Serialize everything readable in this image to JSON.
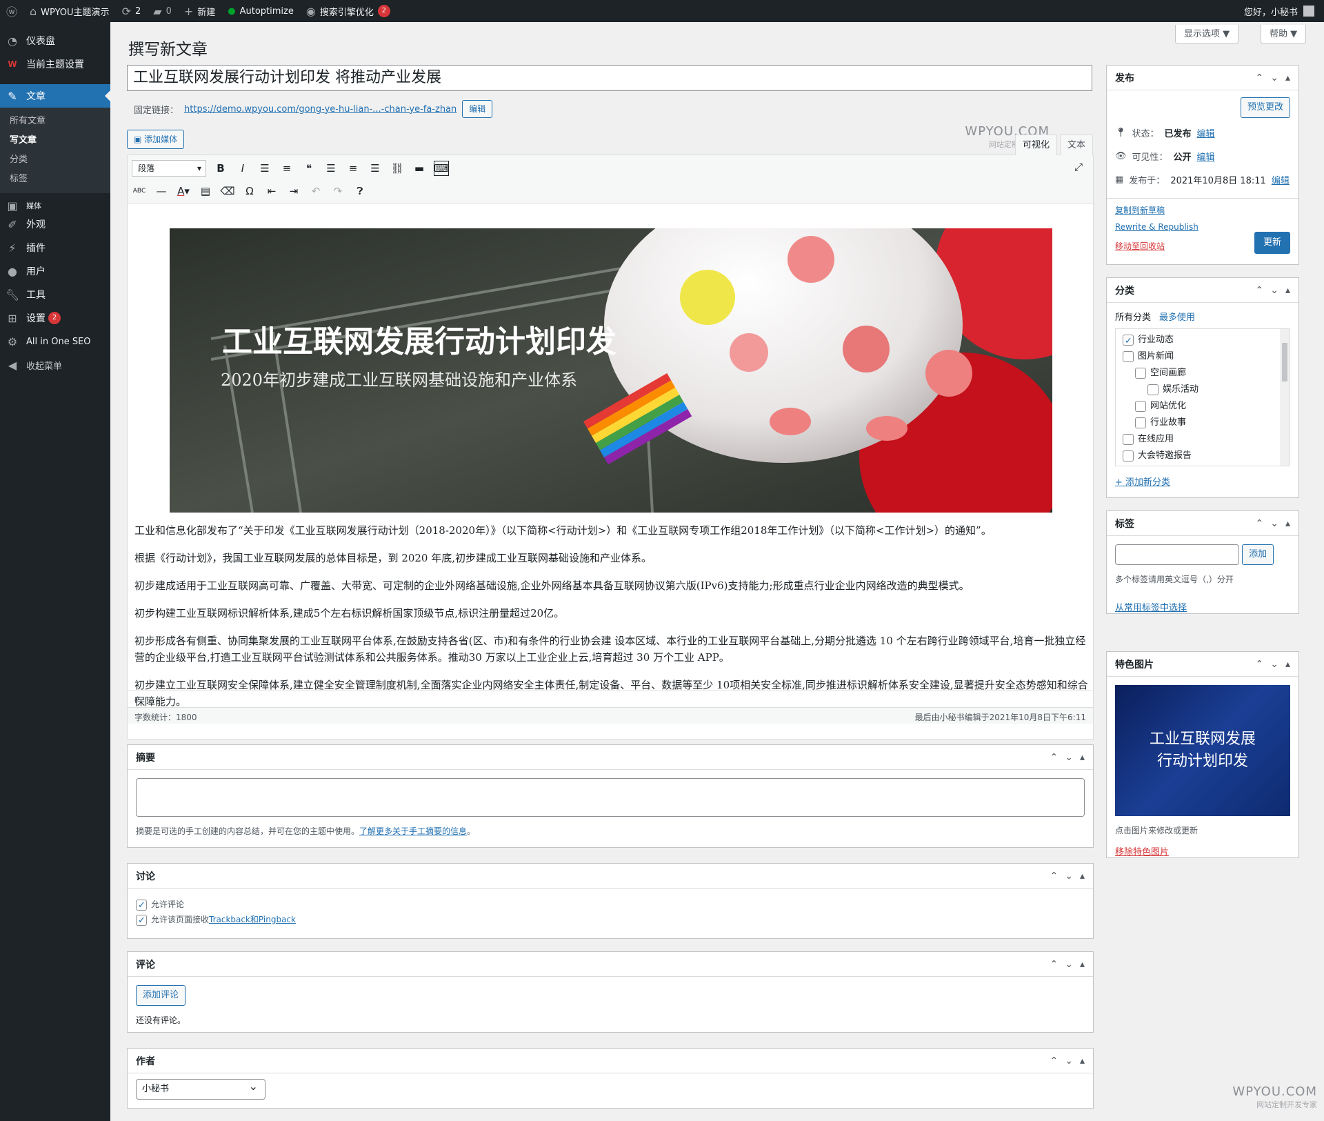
{
  "adminbar": {
    "site_name": "WPYOU主题演示",
    "updates_count": "2",
    "comments_count": "0",
    "new_label": "新建",
    "autoptimize_label": "Autoptimize",
    "seo_label": "搜索引擎优化",
    "seo_badge": "2",
    "greeting": "您好，小秘书"
  },
  "sidebar": {
    "dashboard": "仪表盘",
    "theme_settings": "当前主题设置",
    "posts": "文章",
    "submenu": [
      "所有文章",
      "写文章",
      "分类",
      "标签"
    ],
    "media": "媒体",
    "appearance": "外观",
    "plugins": "插件",
    "users": "用户",
    "tools": "工具",
    "settings": "设置",
    "settings_badge": "2",
    "aioseo": "All in One SEO",
    "collapse": "收起菜单"
  },
  "page": {
    "title": "撰写新文章",
    "screen_options": "显示选项 ▼",
    "help": "帮助 ▼"
  },
  "post": {
    "title": "工业互联网发展行动计划印发 将推动产业发展",
    "permalink_label": "固定链接：",
    "permalink_url": "https://demo.wpyou.com/gong-ye-hu-lian-...-chan-ye-fa-zhan",
    "permalink_edit": "编辑",
    "add_media": "添加媒体",
    "tab_visual": "可视化",
    "tab_text": "文本",
    "format_select": "段落",
    "hero_title": "工业互联网发展行动计划印发",
    "hero_subtitle": "2020年初步建成工业互联网基础设施和产业体系",
    "paragraphs": [
      "工业和信息化部发布了“关于印发《工业互联网发展行动计划（2018-2020年）》（以下简称<行动计划>）和《工业互联网专项工作组2018年工作计划》（以下简称<工作计划>）的通知”。",
      "根据《行动计划》，我国工业互联网发展的总体目标是，到 2020 年底,初步建成工业互联网基础设施和产业体系。",
      "初步建成适用于工业互联网高可靠、广覆盖、大带宽、可定制的企业外网络基础设施,企业外网络基本具备互联网协议第六版(IPv6)支持能力;形成重点行业企业内网络改造的典型模式。",
      "初步构建工业互联网标识解析体系,建成5个左右标识解析国家顶级节点,标识注册量超过20亿。",
      "初步形成各有侧重、协同集聚发展的工业互联网平台体系,在鼓励支持各省(区、市)和有条件的行业协会建 设本区域、本行业的工业互联网平台基础上,分期分批遴选 10 个左右跨行业跨领域平台,培育一批独立经营的企业级平台,打造工业互联网平台试验测试体系和公共服务体系。推动30 万家以上工业企业上云,培育超过 30 万个工业 APP。",
      "初步建立工业互联网安全保障体系,建立健全安全管理制度机制,全面落实企业内网络安全主体责任,制定设备、平台、数据等至少 10项相关安全标准,同步推进标识解析体系安全建设,显著提升安全态势感知和综合保障能力。"
    ],
    "path": "P",
    "word_count": "字数统计：1800",
    "last_edited": "最后由小秘书编辑于2021年10月8日下午6:11"
  },
  "excerpt": {
    "title": "摘要",
    "help": "摘要是可选的手工创建的内容总结，并可在您的主题中使用。",
    "link": "了解更多关于手工摘要的信息",
    "period": "。"
  },
  "discussion": {
    "title": "讨论",
    "allow_comments": "允许评论",
    "allow_pings_prefix": "允许该页面接收",
    "allow_pings_link": "Trackback和Pingback"
  },
  "comments": {
    "title": "评论",
    "add_button": "添加评论",
    "none": "还没有评论。"
  },
  "author": {
    "title": "作者",
    "selected": "小秘书"
  },
  "publish": {
    "title": "发布",
    "preview": "预览更改",
    "status_label": "状态：",
    "status_value": "已发布",
    "visibility_label": "可见性：",
    "visibility_value": "公开",
    "published_label": "发布于：",
    "published_value": "2021年10月8日 18:11",
    "edit": "编辑",
    "copy_draft": "复制到新草稿",
    "rewrite": "Rewrite & Republish",
    "trash": "移动至回收站",
    "update": "更新"
  },
  "categories": {
    "title": "分类",
    "tab_all": "所有分类",
    "tab_popular": "最多使用",
    "items": [
      "行业动态",
      "图片新闻",
      "空间画廊",
      "娱乐活动",
      "网站优化",
      "行业故事",
      "在线应用",
      "大会特邀报告"
    ],
    "add_new": "+ 添加新分类"
  },
  "tags": {
    "title": "标签",
    "add": "添加",
    "hint": "多个标签请用英文逗号（,）分开",
    "choose": "从常用标签中选择"
  },
  "featured": {
    "title": "特色图片",
    "image_line1": "工业互联网发展",
    "image_line2": "行动计划印发",
    "hint": "点击图片来修改或更新",
    "remove": "移除特色图片"
  },
  "watermark": {
    "logo": "WPYOU.COM",
    "sub": "网站定制开发专家"
  },
  "colors": {
    "admin_dark": "#1d2327",
    "accent": "#2271b1",
    "danger": "#d63638"
  }
}
